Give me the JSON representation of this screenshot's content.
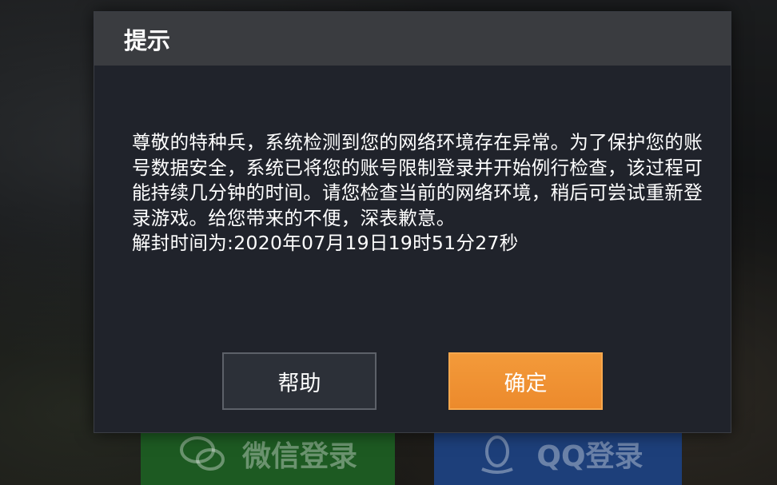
{
  "dialog": {
    "title": "提示",
    "message": "尊敬的特种兵，系统检测到您的网络环境存在异常。为了保护您的账号数据安全，系统已将您的账号限制登录并开始例行检查，该过程可能持续几分钟的时间。请您检查当前的网络环境，稍后可尝试重新登录游戏。给您带来的不便，深表歉意。",
    "unban_time": "解封时间为:2020年07月19日19时51分27秒",
    "help_label": "帮助",
    "confirm_label": "确定"
  },
  "background": {
    "wechat_login_label": "微信登录",
    "qq_login_label": "QQ登录"
  },
  "colors": {
    "confirm": "#f0922f",
    "wechat": "#1d5a22",
    "qq": "#1d3f7a"
  },
  "icons": [
    "wechat-icon",
    "qq-icon"
  ]
}
